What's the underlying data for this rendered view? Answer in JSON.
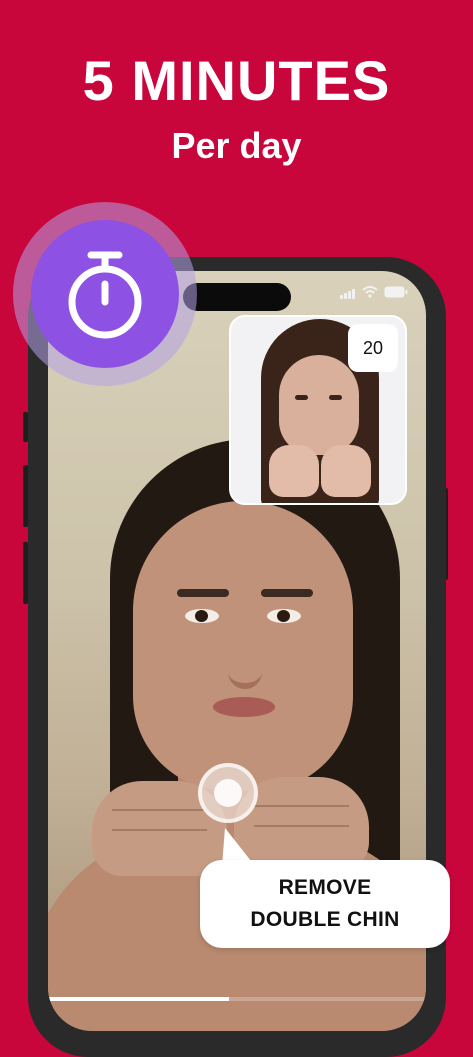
{
  "headline": {
    "title": "5 MINUTES",
    "subtitle": "Per day"
  },
  "colors": {
    "background": "#c8063c",
    "timer_accent": "#8d51e3",
    "text_on_background": "#ffffff"
  },
  "timer_badge": {
    "icon": "stopwatch-icon"
  },
  "instructor_video": {
    "rep_counter": "20"
  },
  "callout": {
    "line1": "REMOVE",
    "line2": "DOUBLE CHIN"
  },
  "video_progress": 0.48
}
